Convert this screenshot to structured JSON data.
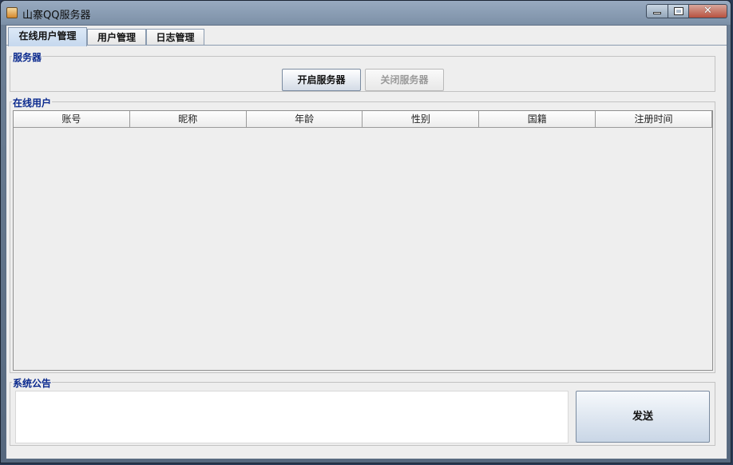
{
  "window": {
    "title": "山寨QQ服务器",
    "controls": {
      "minimize": "minimize-icon",
      "maximize": "maximize-icon",
      "close": "✕"
    }
  },
  "tabs": [
    {
      "label": "在线用户管理",
      "active": true
    },
    {
      "label": "用户管理",
      "active": false
    },
    {
      "label": "日志管理",
      "active": false
    }
  ],
  "server_group": {
    "title": "服务器",
    "start_label": "开启服务器",
    "stop_label": "关闭服务器",
    "stop_disabled": true
  },
  "online_users": {
    "title": "在线用户",
    "columns": [
      "账号",
      "昵称",
      "年龄",
      "性别",
      "国籍",
      "注册时间"
    ],
    "rows": []
  },
  "announcement": {
    "title": "系统公告",
    "text": "",
    "send_label": "发送"
  },
  "colors": {
    "group_title": "#0b2a8e",
    "panel_bg": "#eeeeee"
  }
}
